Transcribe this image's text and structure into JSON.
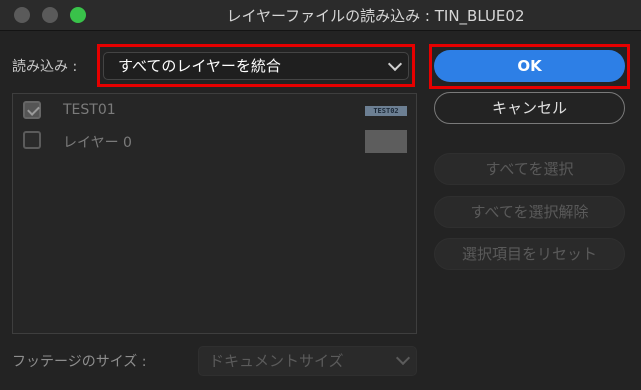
{
  "window": {
    "title": "レイヤーファイルの読み込み : TIN_BLUE02"
  },
  "import": {
    "label": "読み込み :",
    "selected": "すべてのレイヤーを統合"
  },
  "layers": [
    {
      "name": "TEST01",
      "checked": true,
      "thumb_text": "TEST02"
    },
    {
      "name": "レイヤー 0",
      "checked": false
    }
  ],
  "buttons": {
    "ok": "OK",
    "cancel": "キャンセル",
    "select_all": "すべてを選択",
    "deselect_all": "すべてを選択解除",
    "reset_selection": "選択項目をリセット"
  },
  "footage": {
    "label": "フッテージのサイズ :",
    "selected": "ドキュメントサイズ"
  },
  "colors": {
    "highlight": "#e60000",
    "primary": "#2d7fe6"
  }
}
